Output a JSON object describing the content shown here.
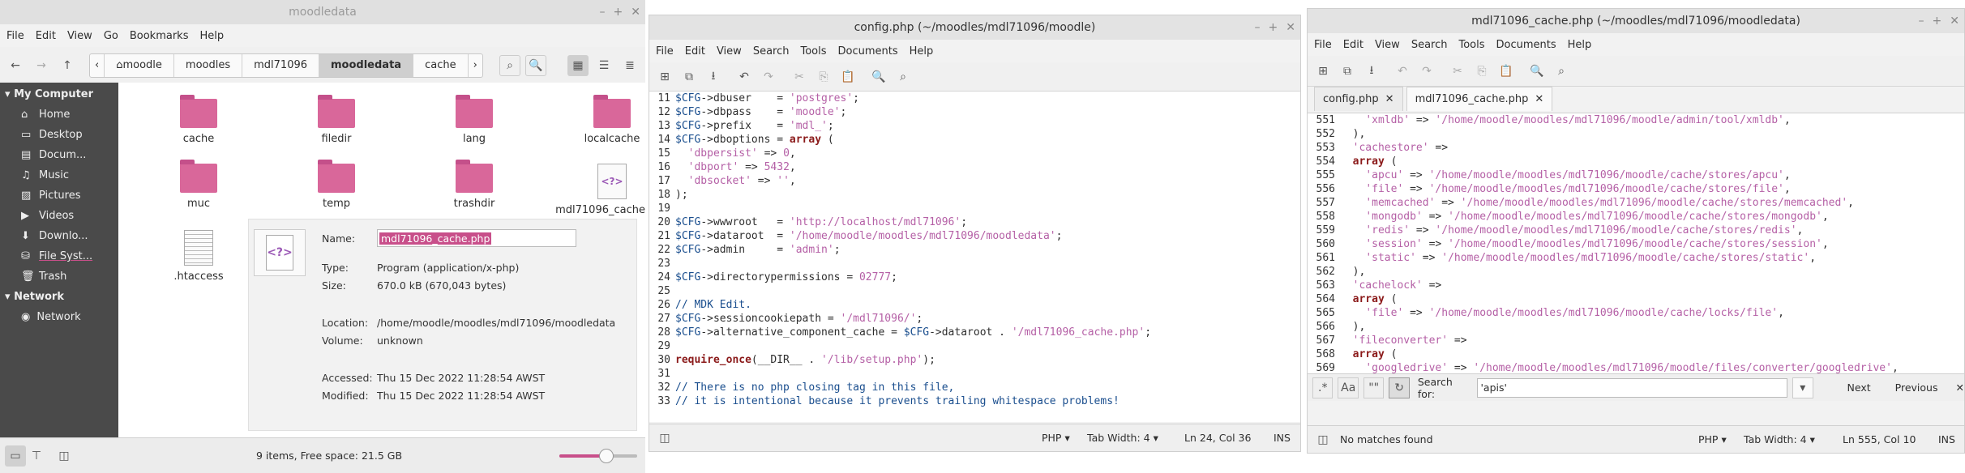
{
  "nemo": {
    "title": "moodledata",
    "menu": [
      "File",
      "Edit",
      "View",
      "Go",
      "Bookmarks",
      "Help"
    ],
    "crumbs": [
      "moodle",
      "moodles",
      "mdl71096",
      "moodledata",
      "cache"
    ],
    "sidebar": {
      "my_computer": "My Computer",
      "items": [
        "Home",
        "Desktop",
        "Docum...",
        "Music",
        "Pictures",
        "Videos",
        "Downlo...",
        "File Syst...",
        "Trash"
      ],
      "network_head": "Network",
      "network_items": [
        "Network"
      ]
    },
    "files": [
      {
        "name": "cache",
        "type": "folder"
      },
      {
        "name": "filedir",
        "type": "folder"
      },
      {
        "name": "lang",
        "type": "folder"
      },
      {
        "name": "localcache",
        "type": "folder"
      },
      {
        "name": "muc",
        "type": "folder"
      },
      {
        "name": "temp",
        "type": "folder"
      },
      {
        "name": "trashdir",
        "type": "folder"
      },
      {
        "name": "mdl71096_cache.php",
        "type": "php"
      },
      {
        "name": ".htaccess",
        "type": "text"
      }
    ],
    "info": {
      "name_label": "Name:",
      "name_value": "mdl71096_cache.php",
      "type_label": "Type:",
      "type_value": "Program (application/x-php)",
      "size_label": "Size:",
      "size_value": "670.0 kB (670,043 bytes)",
      "location_label": "Location:",
      "location_value": "/home/moodle/moodles/mdl71096/moodledata",
      "volume_label": "Volume:",
      "volume_value": "unknown",
      "accessed_label": "Accessed:",
      "accessed_value": "Thu 15 Dec 2022 11:28:54 AWST",
      "modified_label": "Modified:",
      "modified_value": "Thu 15 Dec 2022 11:28:54 AWST"
    },
    "status": "9 items, Free space: 21.5 GB",
    "zoom_level": 0.6
  },
  "editor1": {
    "title": "config.php (~/moodles/mdl71096/moodle)",
    "menu": [
      "File",
      "Edit",
      "View",
      "Search",
      "Tools",
      "Documents",
      "Help"
    ],
    "lines": [
      {
        "n": "11",
        "t": "$CFG->dbuser    = 'postgres';"
      },
      {
        "n": "12",
        "t": "$CFG->dbpass    = 'moodle';"
      },
      {
        "n": "13",
        "t": "$CFG->prefix    = 'mdl_';"
      },
      {
        "n": "14",
        "t": "$CFG->dboptions = array ("
      },
      {
        "n": "15",
        "t": "  'dbpersist' => 0,"
      },
      {
        "n": "16",
        "t": "  'dbport' => 5432,"
      },
      {
        "n": "17",
        "t": "  'dbsocket' => '',"
      },
      {
        "n": "18",
        "t": ");"
      },
      {
        "n": "19",
        "t": ""
      },
      {
        "n": "20",
        "t": "$CFG->wwwroot   = 'http://localhost/mdl71096';"
      },
      {
        "n": "21",
        "t": "$CFG->dataroot  = '/home/moodle/moodles/mdl71096/moodledata';"
      },
      {
        "n": "22",
        "t": "$CFG->admin     = 'admin';"
      },
      {
        "n": "23",
        "t": ""
      },
      {
        "n": "24",
        "t": "$CFG->directorypermissions = 02777;"
      },
      {
        "n": "25",
        "t": ""
      },
      {
        "n": "26",
        "t": "// MDK Edit."
      },
      {
        "n": "27",
        "t": "$CFG->sessioncookiepath = '/mdl71096/';"
      },
      {
        "n": "28",
        "t": "$CFG->alternative_component_cache = $CFG->dataroot . '/mdl71096_cache.php';"
      },
      {
        "n": "29",
        "t": ""
      },
      {
        "n": "30",
        "t": "require_once(__DIR__ . '/lib/setup.php');"
      },
      {
        "n": "31",
        "t": ""
      },
      {
        "n": "32",
        "t": "// There is no php closing tag in this file,"
      },
      {
        "n": "33",
        "t": "// it is intentional because it prevents trailing whitespace problems!"
      }
    ],
    "status": {
      "lang": "PHP",
      "tab_width": "Tab Width:  4",
      "pos": "Ln 24, Col 36",
      "mode": "INS"
    }
  },
  "editor2": {
    "title": "mdl71096_cache.php (~/moodles/mdl71096/moodledata)",
    "menu": [
      "File",
      "Edit",
      "View",
      "Search",
      "Tools",
      "Documents",
      "Help"
    ],
    "tabs": [
      "config.php",
      "mdl71096_cache.php"
    ],
    "lines": [
      {
        "n": "551",
        "t": "    'xmldb' => '/home/moodle/moodles/mdl71096/moodle/admin/tool/xmldb',"
      },
      {
        "n": "552",
        "t": "  ),"
      },
      {
        "n": "553",
        "t": "  'cachestore' =>"
      },
      {
        "n": "554",
        "t": "  array ("
      },
      {
        "n": "555",
        "t": "    'apcu' => '/home/moodle/moodles/mdl71096/moodle/cache/stores/apcu',"
      },
      {
        "n": "556",
        "t": "    'file' => '/home/moodle/moodles/mdl71096/moodle/cache/stores/file',"
      },
      {
        "n": "557",
        "t": "    'memcached' => '/home/moodle/moodles/mdl71096/moodle/cache/stores/memcached',"
      },
      {
        "n": "558",
        "t": "    'mongodb' => '/home/moodle/moodles/mdl71096/moodle/cache/stores/mongodb',"
      },
      {
        "n": "559",
        "t": "    'redis' => '/home/moodle/moodles/mdl71096/moodle/cache/stores/redis',"
      },
      {
        "n": "560",
        "t": "    'session' => '/home/moodle/moodles/mdl71096/moodle/cache/stores/session',"
      },
      {
        "n": "561",
        "t": "    'static' => '/home/moodle/moodles/mdl71096/moodle/cache/stores/static',"
      },
      {
        "n": "562",
        "t": "  ),"
      },
      {
        "n": "563",
        "t": "  'cachelock' =>"
      },
      {
        "n": "564",
        "t": "  array ("
      },
      {
        "n": "565",
        "t": "    'file' => '/home/moodle/moodles/mdl71096/moodle/cache/locks/file',"
      },
      {
        "n": "566",
        "t": "  ),"
      },
      {
        "n": "567",
        "t": "  'fileconverter' =>"
      },
      {
        "n": "568",
        "t": "  array ("
      },
      {
        "n": "569",
        "t": "    'googledrive' => '/home/moodle/moodles/mdl71096/moodle/files/converter/googledrive',"
      }
    ],
    "search": {
      "label": "Search for:",
      "value": "'apis'",
      "next": "Next",
      "previous": "Previous",
      "regex": ".*",
      "case": "Aa",
      "quote": "\"\""
    },
    "status": {
      "msg": "No matches found",
      "lang": "PHP",
      "tab_width": "Tab Width:  4",
      "pos": "Ln 555, Col 10",
      "mode": "INS"
    }
  }
}
